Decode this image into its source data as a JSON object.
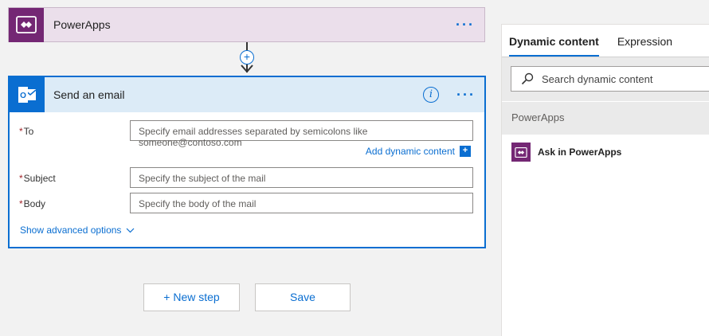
{
  "trigger": {
    "title": "PowerApps",
    "icon": "powerapps-icon",
    "color": "#742774"
  },
  "action": {
    "title": "Send an email",
    "icon": "outlook-icon",
    "accent": "#0a6ed1",
    "fields": {
      "to": {
        "label": "To",
        "placeholder": "Specify email addresses separated by semicolons like someone@contoso.com"
      },
      "subject": {
        "label": "Subject",
        "placeholder": "Specify the subject of the mail"
      },
      "body": {
        "label": "Body",
        "placeholder": "Specify the body of the mail"
      }
    },
    "required_marker": "*",
    "add_dynamic_label": "Add dynamic content",
    "add_dynamic_plus": "+",
    "show_advanced": "Show advanced options"
  },
  "connector": {
    "add_symbol": "+"
  },
  "buttons": {
    "new_step": "+ New step",
    "save": "Save"
  },
  "panel": {
    "tabs": [
      "Dynamic content",
      "Expression"
    ],
    "active_tab": "Dynamic content",
    "search_placeholder": "Search dynamic content",
    "group": "PowerApps",
    "items": [
      {
        "label": "Ask in PowerApps",
        "icon": "powerapps-icon"
      }
    ]
  }
}
